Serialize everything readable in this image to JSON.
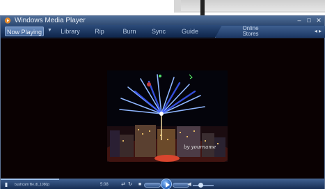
{
  "window": {
    "title": "Windows Media Player",
    "controls": [
      "–",
      "□",
      "✕"
    ]
  },
  "tabs": {
    "now_playing": "Now Playing",
    "library": "Library",
    "rip": "Rip",
    "burn": "Burn",
    "sync": "Sync",
    "guide": "Guide",
    "online_stores": "Online Stores"
  },
  "video": {
    "watermark": "by yourname"
  },
  "player": {
    "track_name": "bushcam file.dl_1080p",
    "time": "5:08",
    "seek_progress": 0.18,
    "volume_level": 0.35
  },
  "colors": {
    "accent": "#3c5f93",
    "video_bg": "#0a0102"
  }
}
